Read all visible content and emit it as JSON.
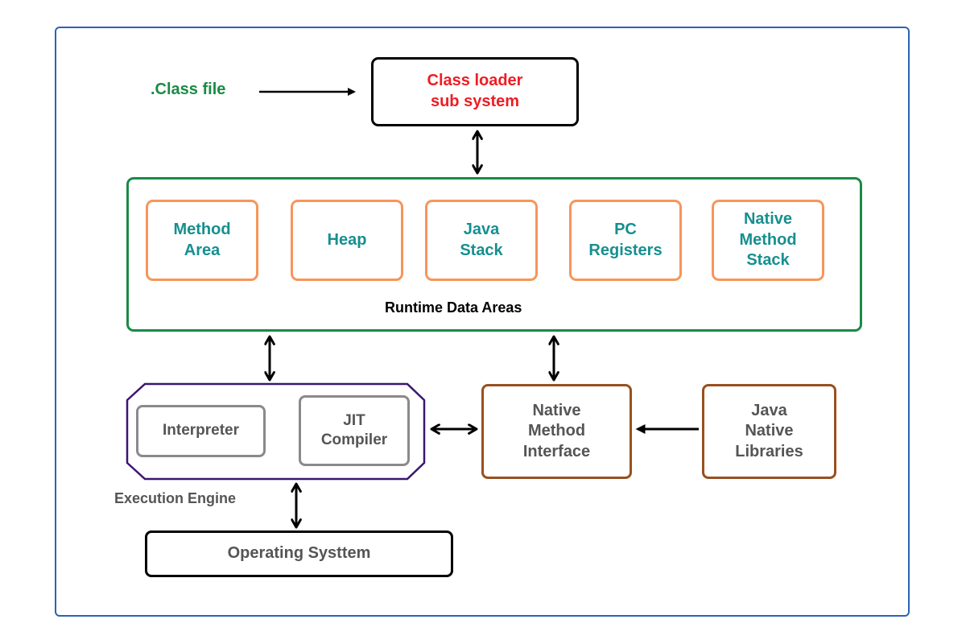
{
  "colors": {
    "frame": "#2b63b5",
    "class_file_text": "#1a8a45",
    "class_loader_text": "#ee1c24",
    "runtime_border": "#1a8a45",
    "memory_border": "#f7955a",
    "memory_text": "#168f8f",
    "execution_border": "#3b1670",
    "engine_component_border": "#8a8a8a",
    "native_border": "#99501f",
    "gray_text": "#555555",
    "arrow": "#000000"
  },
  "class_file": {
    "label": ".Class file"
  },
  "class_loader": {
    "line1": "Class loader",
    "line2": "sub system"
  },
  "runtime_data_areas": {
    "title": "Runtime Data Areas",
    "areas": [
      {
        "lines": [
          "Method",
          "Area"
        ]
      },
      {
        "lines": [
          "Heap"
        ]
      },
      {
        "lines": [
          "Java",
          "Stack"
        ]
      },
      {
        "lines": [
          "PC",
          "Registers"
        ]
      },
      {
        "lines": [
          "Native",
          "Method",
          "Stack"
        ]
      }
    ]
  },
  "execution_engine": {
    "title": "Execution Engine",
    "interpreter": "Interpreter",
    "jit": {
      "line1": "JIT",
      "line2": "Compiler"
    }
  },
  "native_method_interface": {
    "line1": "Native",
    "line2": "Method",
    "line3": "Interface"
  },
  "java_native_libraries": {
    "line1": "Java",
    "line2": "Native",
    "line3": "Libraries"
  },
  "operating_system": {
    "label": "Operating Systtem"
  }
}
